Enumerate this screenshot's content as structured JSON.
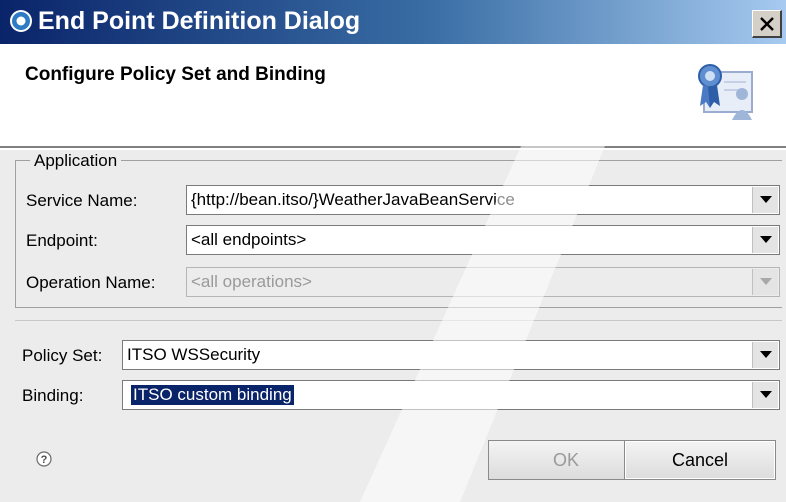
{
  "window": {
    "title": "End Point Definition Dialog"
  },
  "banner": {
    "title": "Configure Policy Set and Binding"
  },
  "application_group": {
    "legend": "Application",
    "service_name": {
      "label": "Service Name:",
      "value": "{http://bean.itso/}WeatherJavaBeanService"
    },
    "endpoint": {
      "label": "Endpoint:",
      "value": "<all endpoints>"
    },
    "operation_name": {
      "label": "Operation Name:",
      "value": "<all operations>"
    }
  },
  "policy_set": {
    "label": "Policy Set:",
    "value": "ITSO WSSecurity"
  },
  "binding": {
    "label": "Binding:",
    "value": "ITSO custom binding"
  },
  "buttons": {
    "ok": "OK",
    "cancel": "Cancel"
  },
  "colors": {
    "title_bar_start": "#0a246a",
    "title_bar_end": "#a6caf0",
    "selection": "#0a246a"
  },
  "icons": {
    "title": "eclipse-icon",
    "close": "close-icon",
    "banner": "certificate-user-icon",
    "help": "help-icon"
  }
}
